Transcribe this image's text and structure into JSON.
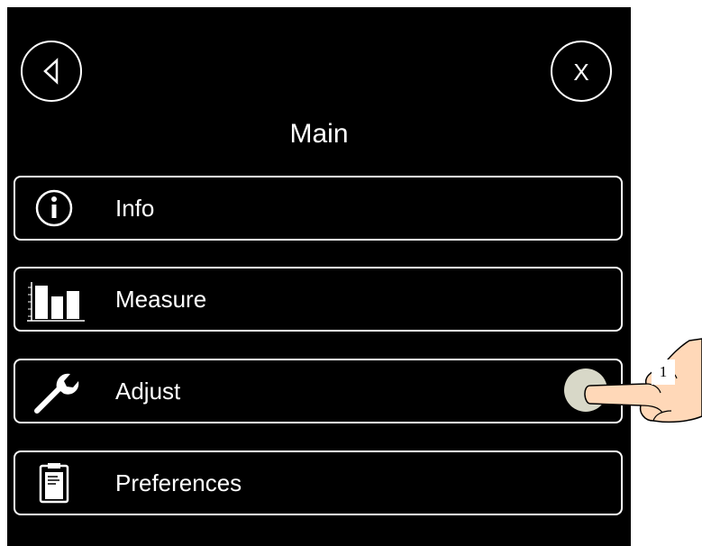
{
  "screen": {
    "title": "Main",
    "close_label": "X"
  },
  "menu": [
    {
      "label": "Info",
      "icon": "info-icon"
    },
    {
      "label": "Measure",
      "icon": "bar-chart-icon"
    },
    {
      "label": "Adjust",
      "icon": "wrench-icon"
    },
    {
      "label": "Preferences",
      "icon": "clipboard-icon"
    }
  ],
  "annotation": {
    "number": "1",
    "icon": "pointing-hand-icon"
  },
  "colors": {
    "screen_background": "#000000",
    "foreground": "#ffffff",
    "touch_indicator": "#d8d8c8"
  }
}
